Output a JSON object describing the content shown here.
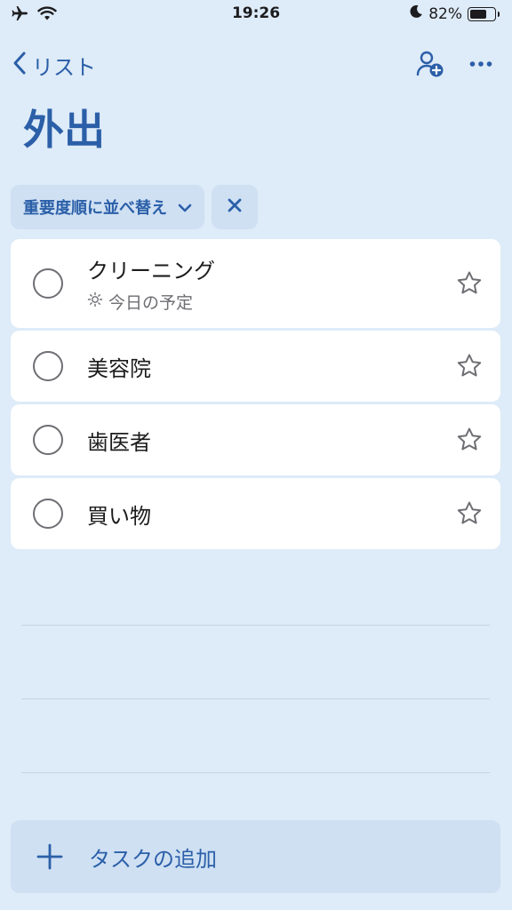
{
  "status_bar": {
    "time": "19:26",
    "battery_percent": "82%",
    "battery_level": 0.82,
    "icons": [
      "airplane-icon",
      "wifi-icon",
      "moon-icon",
      "battery-icon"
    ]
  },
  "nav": {
    "back_label": "リスト",
    "actions": [
      "add-person-icon",
      "more-icon"
    ]
  },
  "page": {
    "title": "外出"
  },
  "sort": {
    "label": "重要度順に並べ替え",
    "icons": [
      "chevron-down-icon",
      "close-icon"
    ]
  },
  "tasks": [
    {
      "title": "クリーニング",
      "subtitle": "今日の予定",
      "subtitle_icon": "sun-icon"
    },
    {
      "title": "美容院"
    },
    {
      "title": "歯医者"
    },
    {
      "title": "買い物"
    }
  ],
  "add_task": {
    "label": "タスクの追加",
    "icon": "plus-icon"
  },
  "colors": {
    "accent": "#2b5fa8",
    "background": "#deebf8",
    "chip": "#cfe0f3"
  }
}
